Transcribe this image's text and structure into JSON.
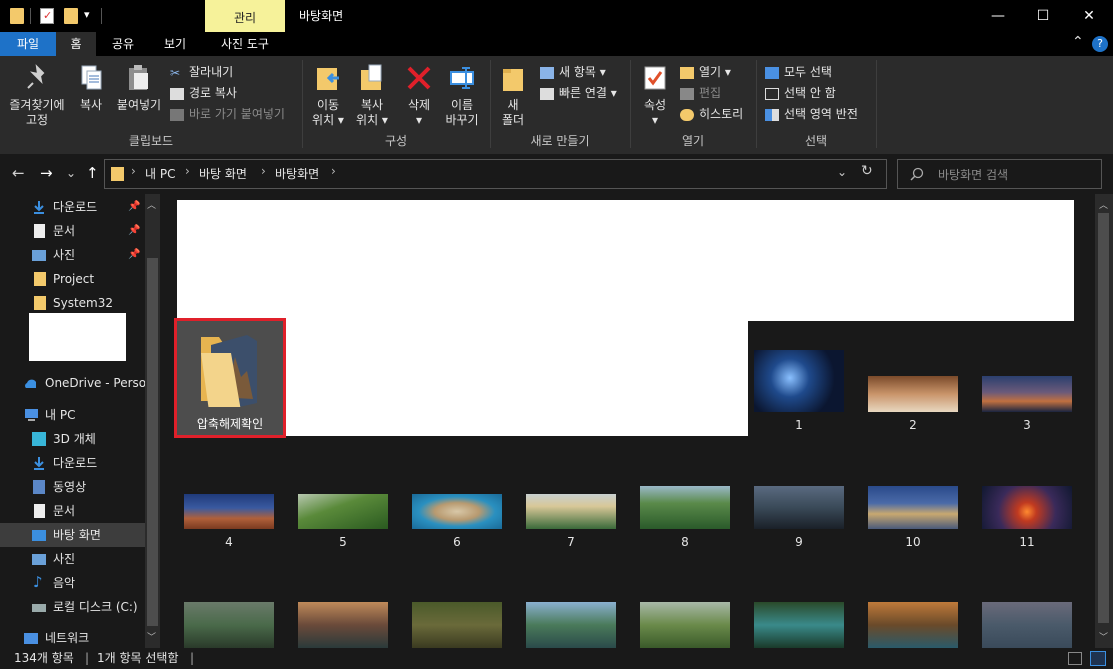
{
  "titlebar": {
    "contextual_tab": "관리",
    "window_title": "바탕화면",
    "minimize": "—",
    "maximize": "☐",
    "close": "✕",
    "dropdown_glyph": "▾"
  },
  "tabs": {
    "file": "파일",
    "home": "홈",
    "share": "공유",
    "view": "보기",
    "picture_tools": "사진 도구",
    "collapse_glyph": "⌃",
    "help_glyph": "?"
  },
  "ribbon": {
    "clipboard": {
      "pin_quick": "즐겨찾기에\n고정",
      "copy": "복사",
      "paste": "붙여넣기",
      "cut": "잘라내기",
      "copy_path": "경로 복사",
      "paste_shortcut": "바로 가기 붙여넣기",
      "label": "클립보드"
    },
    "organize": {
      "move_to": "이동\n위치 ▾",
      "copy_to": "복사\n위치 ▾",
      "delete": "삭제\n▾",
      "rename": "이름\n바꾸기",
      "label": "구성"
    },
    "new": {
      "new_folder": "새\n폴더",
      "new_item": "새 항목 ▾",
      "easy_access": "빠른 연결 ▾",
      "label": "새로 만들기"
    },
    "open": {
      "properties": "속성\n▾",
      "open": "열기 ▾",
      "edit": "편집",
      "history": "히스토리",
      "label": "열기"
    },
    "select": {
      "select_all": "모두 선택",
      "select_none": "선택 안 함",
      "invert": "선택 영역 반전",
      "label": "선택"
    }
  },
  "navigation": {
    "back": "←",
    "forward": "→",
    "recent": "⌄",
    "up": "↑",
    "breadcrumb": [
      "내 PC",
      "바탕 화면",
      "바탕화면"
    ],
    "crumb_sep": "›",
    "dropdown": "⌄",
    "refresh": "↻",
    "search_placeholder": "바탕화면 검색"
  },
  "nav_pane": {
    "quick_access": [
      {
        "label": "다운로드",
        "pinned": true,
        "icon": "download-icon"
      },
      {
        "label": "문서",
        "pinned": true,
        "icon": "document-icon"
      },
      {
        "label": "사진",
        "pinned": true,
        "icon": "picture-icon"
      },
      {
        "label": "Project",
        "pinned": false,
        "icon": "folder-icon"
      },
      {
        "label": "System32",
        "pinned": false,
        "icon": "folder-icon"
      }
    ],
    "onedrive": "OneDrive - Persor",
    "this_pc": "내 PC",
    "pc_items": [
      {
        "label": "3D 개체",
        "icon": "3d-objects-icon"
      },
      {
        "label": "다운로드",
        "icon": "download-icon"
      },
      {
        "label": "동영상",
        "icon": "video-icon"
      },
      {
        "label": "문서",
        "icon": "document-icon"
      },
      {
        "label": "바탕 화면",
        "icon": "desktop-icon",
        "selected": true
      },
      {
        "label": "사진",
        "icon": "picture-icon"
      },
      {
        "label": "음악",
        "icon": "music-icon"
      },
      {
        "label": "로컬 디스크 (C:)",
        "icon": "drive-icon"
      }
    ],
    "network": "네트워크"
  },
  "content": {
    "selected_folder": "압축해제확인",
    "row1": [
      "1",
      "2",
      "3"
    ],
    "row2": [
      "4",
      "5",
      "6",
      "7",
      "8",
      "9",
      "10",
      "11"
    ]
  },
  "status": {
    "items_count": "134개 항목",
    "selected": "1개 항목 선택함"
  },
  "colors": {
    "accent": "#1e72c8",
    "selection_border": "#e0202a",
    "manage_tab": "#f6f29a"
  }
}
